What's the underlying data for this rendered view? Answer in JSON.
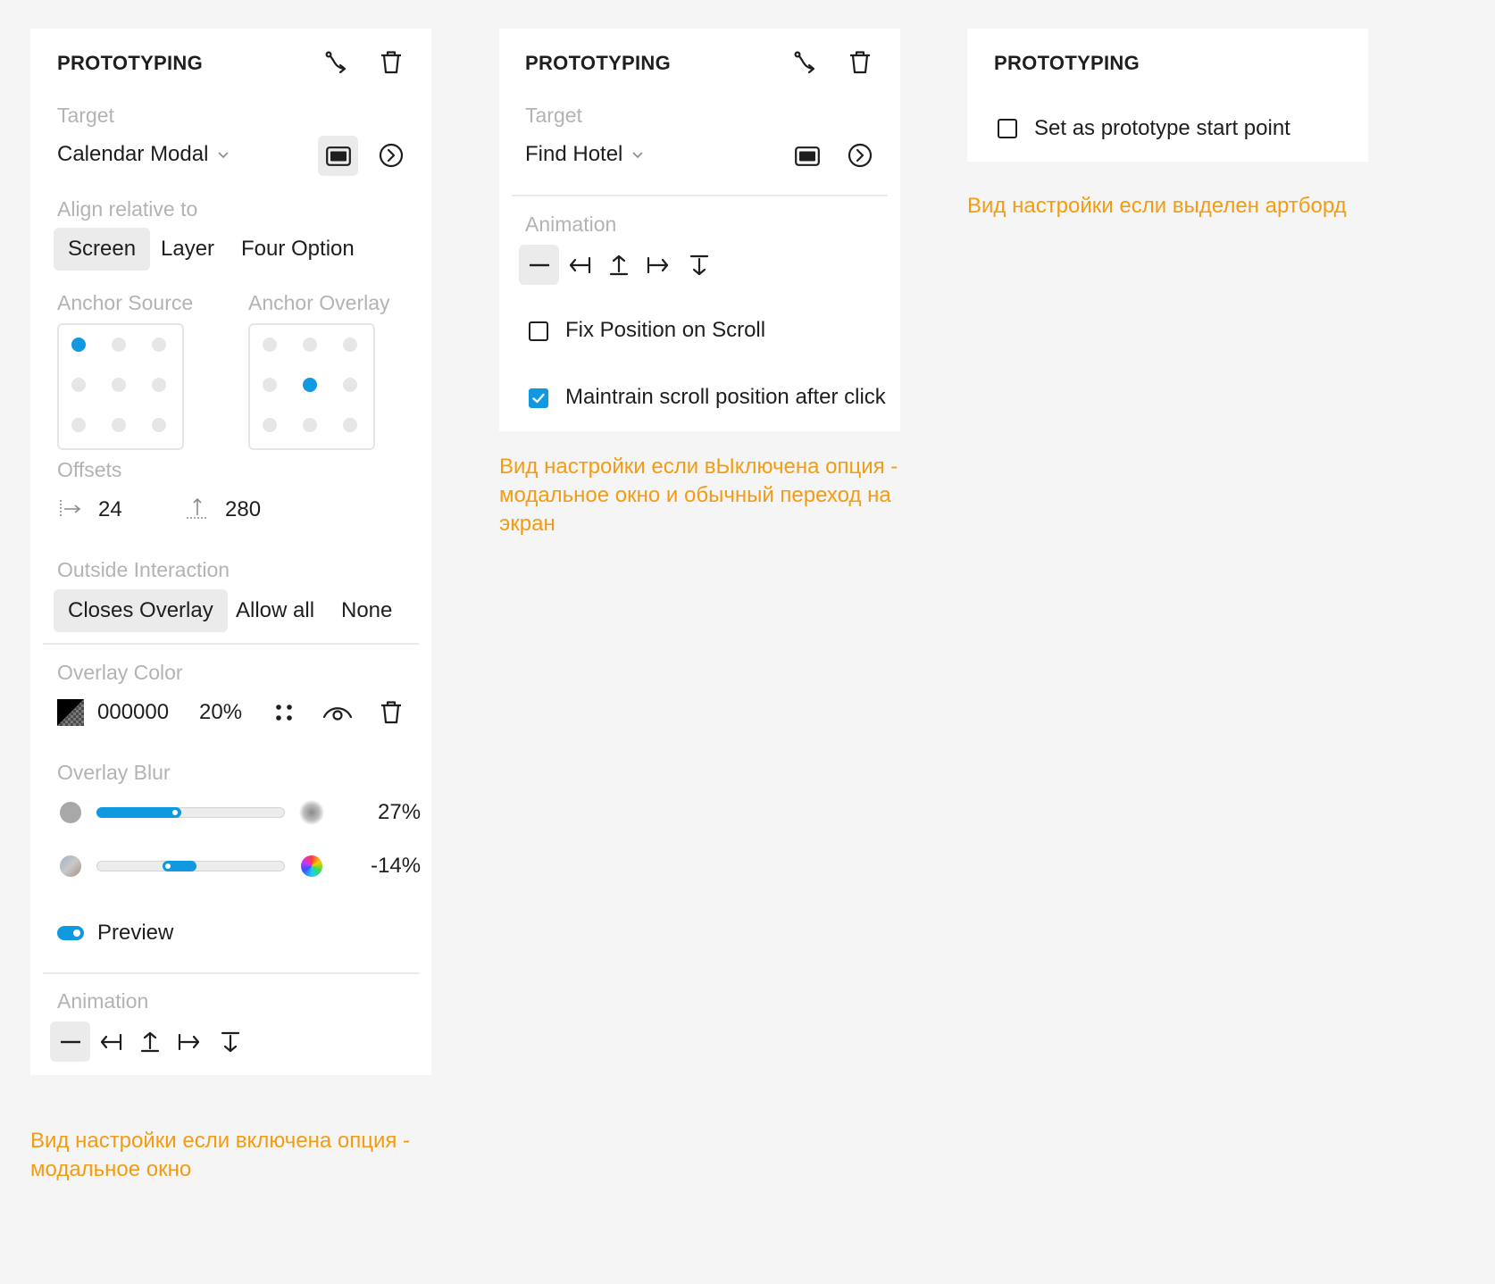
{
  "panel_modal": {
    "title": "PROTOTYPING",
    "target_label": "Target",
    "target_value": "Calendar Modal",
    "align_label": "Align relative to",
    "align_options": [
      "Screen",
      "Layer",
      "Four Option"
    ],
    "align_selected": "Screen",
    "anchor_source_label": "Anchor Source",
    "anchor_overlay_label": "Anchor Overlay",
    "offsets_label": "Offsets",
    "offset_x": "24",
    "offset_y": "280",
    "outside_label": "Outside Interaction",
    "outside_options": [
      "Closes Overlay",
      "Allow all",
      "None"
    ],
    "outside_selected": "Closes Overlay",
    "overlay_color_label": "Overlay Color",
    "overlay_color_hex": "000000",
    "overlay_color_opacity": "20%",
    "overlay_blur_label": "Overlay Blur",
    "blur_value": "27%",
    "blur_level": 0.45,
    "hue_value": "-14%",
    "hue_range": [
      0.35,
      0.53
    ],
    "preview_label": "Preview",
    "preview_on": true,
    "animation_label": "Animation"
  },
  "panel_screen": {
    "title": "PROTOTYPING",
    "target_label": "Target",
    "target_value": "Find Hotel",
    "animation_label": "Animation",
    "fix_position_label": "Fix Position on Scroll",
    "fix_position_checked": false,
    "maintain_scroll_label": "Maintrain scroll position after click",
    "maintain_scroll_checked": true
  },
  "panel_artboard": {
    "title": "PROTOTYPING",
    "start_point_label": "Set as prototype start point",
    "start_point_checked": false
  },
  "notes": {
    "modal": "Вид настройки если включена опция - модальное окно",
    "screen": "Вид настройки если вЫключена опция - модальное окно и обычный переход на экран",
    "artboard": "Вид настройки если выделен артборд"
  },
  "colors": {
    "accent": "#1098e0",
    "note": "#f39c12",
    "muted_label": "#b3b3b3",
    "panel_bg": "#ffffff",
    "page_bg": "#f5f5f5"
  }
}
